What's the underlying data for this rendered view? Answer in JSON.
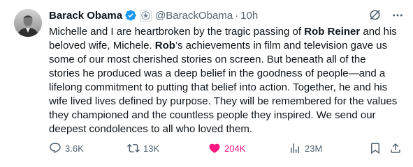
{
  "tweet": {
    "author_name": "Barack Obama",
    "handle": "@BarackObama",
    "separator": "·",
    "time": "10h",
    "text": {
      "p1": "Michelle and I are heartbroken by the tragic passing of ",
      "b1": "Rob Reiner",
      "p2": " and his beloved wife, Michele. ",
      "b2": "Rob",
      "p3": "’s achievements in film and television gave us some of our most cherished stories on screen. But beneath all of the stories he produced was a deep belief in the goodness of people—and a lifelong commitment to putting that belief into action. Together, he and his wife lived lives defined by purpose. They will be remembered for the values they championed and the countless people they inspired. We send our deepest condolences to all who loved them."
    }
  },
  "actions": {
    "replies": "3.6K",
    "reposts": "13K",
    "likes": "204K",
    "views": "23M"
  },
  "icons": {
    "verified": "verified-badge-icon",
    "affiliation": "government-seal-icon",
    "grok": "grok-icon",
    "more": "more-icon",
    "reply": "reply-icon",
    "repost": "repost-icon",
    "like": "heart-icon",
    "views": "views-icon",
    "bookmark": "bookmark-icon",
    "share": "share-icon"
  },
  "colors": {
    "text": "#0f1419",
    "secondary": "#536471",
    "verified": "#1d9bf0",
    "like": "#f91880"
  }
}
